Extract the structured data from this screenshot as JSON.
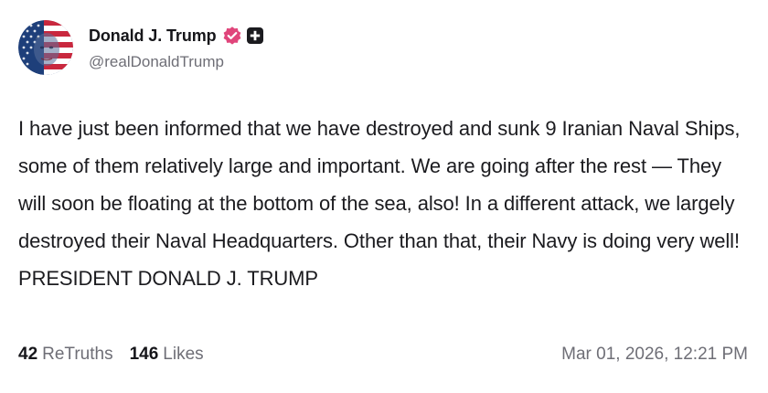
{
  "post": {
    "author": {
      "display_name": "Donald J. Trump",
      "handle": "@realDonaldTrump",
      "verified": true,
      "badge_color": "#e0457b"
    },
    "content": "I have just been informed that we have destroyed and sunk 9 Iranian Naval Ships, some of them relatively large and important. We are going after the rest — They will soon be floating at the bottom of the sea, also! In a different attack, we largely destroyed their Naval Headquarters. Other than that, their Navy is doing very well! PRESIDENT DONALD J. TRUMP",
    "stats": {
      "retruths_count": "42",
      "retruths_label": "ReTruths",
      "likes_count": "146",
      "likes_label": "Likes"
    },
    "timestamp": "Mar 01, 2026, 12:21 PM"
  },
  "icons": {
    "avatar": "avatar-image",
    "verified": "verified-badge-icon",
    "plus": "plus-badge-icon"
  }
}
